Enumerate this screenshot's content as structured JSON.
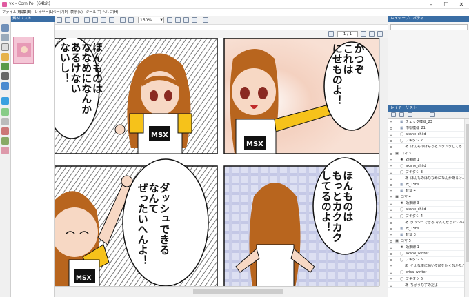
{
  "window": {
    "title": "yx - ComiPo! (64bit)",
    "min": "–",
    "max": "☐",
    "close": "✕"
  },
  "menu": [
    "ファイル(F)",
    "編集(E)",
    "レイヤー(L)",
    "ページ(P)",
    "表示(V)",
    "ツール(T)",
    "ヘルプ(H)"
  ],
  "toolbar": {
    "zoom": "150%"
  },
  "nav": {
    "page": "1 / 1"
  },
  "material_panel": {
    "title": "素材リスト"
  },
  "property_panel": {
    "title": "レイヤープロパティ"
  },
  "layer_panel": {
    "title": "レイヤーリスト",
    "rows": [
      {
        "indent": 1,
        "icon": "img",
        "label": "チェック模様_23"
      },
      {
        "indent": 1,
        "icon": "img",
        "label": "市松模様_21"
      },
      {
        "indent": 1,
        "icon": "char",
        "label": "akane_child"
      },
      {
        "indent": 1,
        "icon": "balloon",
        "label": "フキダシ 2"
      },
      {
        "indent": 2,
        "icon": "text",
        "label": "ほんものはもっとカクカクしてる…"
      },
      {
        "indent": 0,
        "icon": "frame",
        "label": "コマ 3"
      },
      {
        "indent": 1,
        "icon": "effect",
        "label": "効果線 1"
      },
      {
        "indent": 1,
        "icon": "char",
        "label": "akane_child"
      },
      {
        "indent": 1,
        "icon": "balloon",
        "label": "フキダシ 3"
      },
      {
        "indent": 2,
        "icon": "text",
        "label": "ほんものはななめになんかあるけ…"
      },
      {
        "indent": 1,
        "icon": "img",
        "label": "光_15bs"
      },
      {
        "indent": 1,
        "icon": "img",
        "label": "背景 4"
      },
      {
        "indent": 0,
        "icon": "frame",
        "label": "コマ 4"
      },
      {
        "indent": 1,
        "icon": "effect",
        "label": "効果線 3"
      },
      {
        "indent": 1,
        "icon": "char",
        "label": "akane_child"
      },
      {
        "indent": 1,
        "icon": "balloon",
        "label": "フキダシ 4"
      },
      {
        "indent": 2,
        "icon": "text",
        "label": "ダッシュできる なんてぜったいへん…"
      },
      {
        "indent": 1,
        "icon": "img",
        "label": "光_15bs"
      },
      {
        "indent": 1,
        "icon": "img",
        "label": "背景 3"
      },
      {
        "indent": 0,
        "icon": "frame",
        "label": "コマ 5"
      },
      {
        "indent": 1,
        "icon": "effect",
        "label": "効果線 1"
      },
      {
        "indent": 1,
        "icon": "char",
        "label": "akane_winter"
      },
      {
        "indent": 1,
        "icon": "balloon",
        "label": "フキダシ 5"
      },
      {
        "indent": 2,
        "icon": "text",
        "label": "そんな重に騒いで頼を固くなかたこ"
      },
      {
        "indent": 1,
        "icon": "char",
        "label": "erisa_winter"
      },
      {
        "indent": 1,
        "icon": "balloon",
        "label": "フキダシ 6"
      },
      {
        "indent": 2,
        "icon": "text",
        "label": "ちがうなずのだよ"
      }
    ]
  },
  "comic": {
    "panel1": "ほんものは\nななめになんか\nあるけない\nないし！",
    "panel2": "かつぞ\nこれは\nにせものよ！",
    "panel3": "ダッシュできる\nなんて\nぜったいへんよ！",
    "panel4": "ほんものは\nもっとカクカク\nしてるのよ！",
    "shirt": "MSX"
  },
  "colors": {
    "accent": "#3a6ea5",
    "skin": "#f7d8c4",
    "hair": "#b8651e",
    "shirt": "#f6c21a"
  }
}
